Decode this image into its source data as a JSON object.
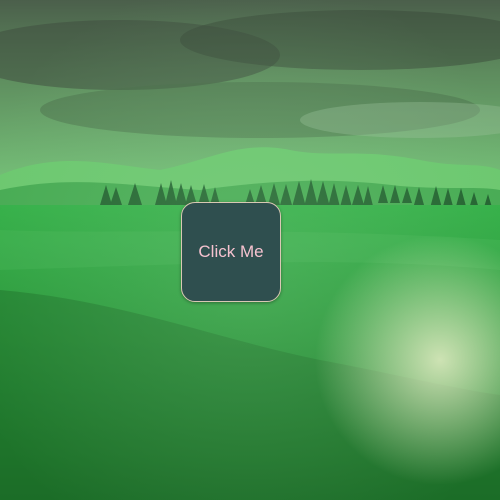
{
  "background": {
    "name": "green-landscape-background",
    "description_colors": {
      "sky": "#5f7d5f",
      "hills": "#67c267",
      "ground": "#2a9a3a",
      "trees": "#1f5a2e"
    }
  },
  "button": {
    "label": "Click Me",
    "background_color": "#2f4f4f",
    "text_color": "#f5c2cf",
    "border_color": "#d9c8b4"
  }
}
